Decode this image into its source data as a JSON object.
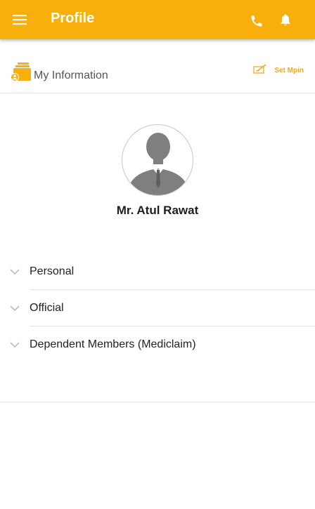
{
  "appbar": {
    "title": "Profile",
    "menu_icon": "hamburger-menu-icon",
    "phone_icon": "phone-icon",
    "bell_icon": "bell-icon",
    "background": "#f8ae0b"
  },
  "info_header": {
    "icon": "folder-user-icon",
    "title": "My Information",
    "mpin_icon": "edit-pen-icon",
    "mpin_label": "Set Mpin"
  },
  "profile": {
    "avatar": "person-silhouette-icon",
    "name": "Mr. Atul Rawat"
  },
  "sections": [
    {
      "label": "Personal",
      "icon": "chevron-down-icon"
    },
    {
      "label": "Official",
      "icon": "chevron-down-icon"
    },
    {
      "label": "Dependent Members (Mediclaim)",
      "icon": "chevron-down-icon"
    }
  ],
  "colors": {
    "accent": "#f8ae0b",
    "accent_text": "#f5a623",
    "divider": "#e3e3e3",
    "avatar_gray": "#7f7f7f"
  }
}
